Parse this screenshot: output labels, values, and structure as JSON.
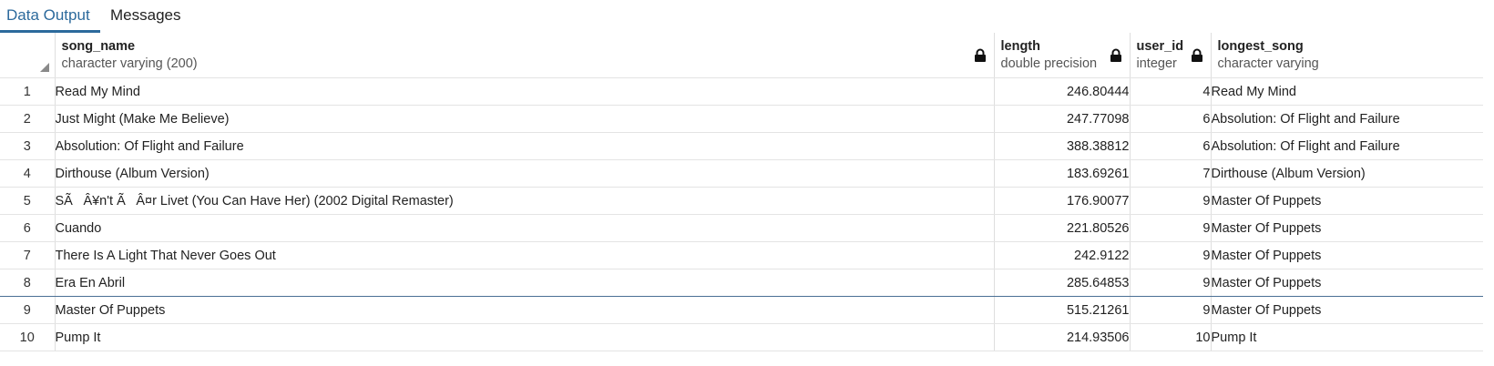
{
  "tabs": [
    {
      "label": "Data Output"
    },
    {
      "label": "Messages"
    }
  ],
  "columns": [
    {
      "name": "song_name",
      "type": "character varying (200)"
    },
    {
      "name": "length",
      "type": "double precision"
    },
    {
      "name": "user_id",
      "type": "integer"
    },
    {
      "name": "longest_song",
      "type": "character varying"
    }
  ],
  "rows": [
    {
      "n": "1",
      "song_name": "Read My Mind",
      "length": "246.80444",
      "user_id": "4",
      "longest_song": "Read My Mind"
    },
    {
      "n": "2",
      "song_name": "Just Might (Make Me Believe)",
      "length": "247.77098",
      "user_id": "6",
      "longest_song": "Absolution: Of Flight and Failure"
    },
    {
      "n": "3",
      "song_name": "Absolution: Of Flight and Failure",
      "length": "388.38812",
      "user_id": "6",
      "longest_song": "Absolution: Of Flight and Failure"
    },
    {
      "n": "4",
      "song_name": "Dirthouse (Album Version)",
      "length": "183.69261",
      "user_id": "7",
      "longest_song": "Dirthouse (Album Version)"
    },
    {
      "n": "5",
      "song_name": "SÃÂ¥n't ÃÂ¤r Livet (You Can Have Her) (2002 Digital Remaster)",
      "length": "176.90077",
      "user_id": "9",
      "longest_song": "Master Of Puppets"
    },
    {
      "n": "6",
      "song_name": "Cuando",
      "length": "221.80526",
      "user_id": "9",
      "longest_song": "Master Of Puppets"
    },
    {
      "n": "7",
      "song_name": "There Is A Light That Never Goes Out",
      "length": "242.9122",
      "user_id": "9",
      "longest_song": "Master Of Puppets"
    },
    {
      "n": "8",
      "song_name": "Era En Abril",
      "length": "285.64853",
      "user_id": "9",
      "longest_song": "Master Of Puppets"
    },
    {
      "n": "9",
      "song_name": "Master Of Puppets",
      "length": "515.21261",
      "user_id": "9",
      "longest_song": "Master Of Puppets"
    },
    {
      "n": "10",
      "song_name": "Pump It",
      "length": "214.93506",
      "user_id": "10",
      "longest_song": "Pump It"
    }
  ]
}
